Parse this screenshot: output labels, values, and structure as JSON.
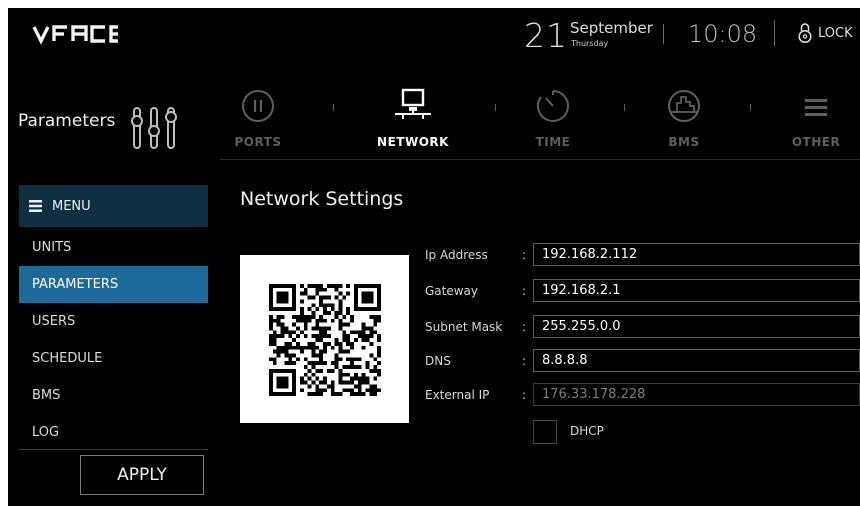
{
  "header": {
    "logo_text": "VFACE",
    "date_day": "21",
    "date_month": "September",
    "weekday": "Thursday",
    "time": "10:08",
    "lock_label": "LOCK"
  },
  "sidebar": {
    "title": "Parameters",
    "menu_label": "MENU",
    "items": [
      {
        "label": "UNITS",
        "active": false
      },
      {
        "label": "PARAMETERS",
        "active": true
      },
      {
        "label": "USERS",
        "active": false
      },
      {
        "label": "SCHEDULE",
        "active": false
      },
      {
        "label": "BMS",
        "active": false
      },
      {
        "label": "LOG",
        "active": false
      }
    ],
    "apply_label": "APPLY"
  },
  "tabs": [
    {
      "label": "PORTS",
      "icon": "pause-circle-icon",
      "active": false
    },
    {
      "label": "NETWORK",
      "icon": "network-icon",
      "active": true
    },
    {
      "label": "TIME",
      "icon": "timer-icon",
      "active": false
    },
    {
      "label": "BMS",
      "icon": "building-icon",
      "active": false
    },
    {
      "label": "OTHER",
      "icon": "hamburger-icon",
      "active": false
    }
  ],
  "network": {
    "title": "Network Settings",
    "fields": [
      {
        "label": "Ip Address",
        "value": "192.168.2.112",
        "readonly": false
      },
      {
        "label": "Gateway",
        "value": "192.168.2.1",
        "readonly": false
      },
      {
        "label": "Subnet Mask",
        "value": "255.255.0.0",
        "readonly": false
      },
      {
        "label": "DNS",
        "value": "8.8.8.8",
        "readonly": false
      },
      {
        "label": "External IP",
        "value": "176.33.178.228",
        "readonly": true
      }
    ],
    "dhcp_label": "DHCP",
    "dhcp_checked": false,
    "colon": ":"
  },
  "colors": {
    "background": "#000000",
    "accent_active": "#1b6a9a",
    "menu_header": "#0f2e40",
    "inactive_text": "#5e5e5e"
  }
}
